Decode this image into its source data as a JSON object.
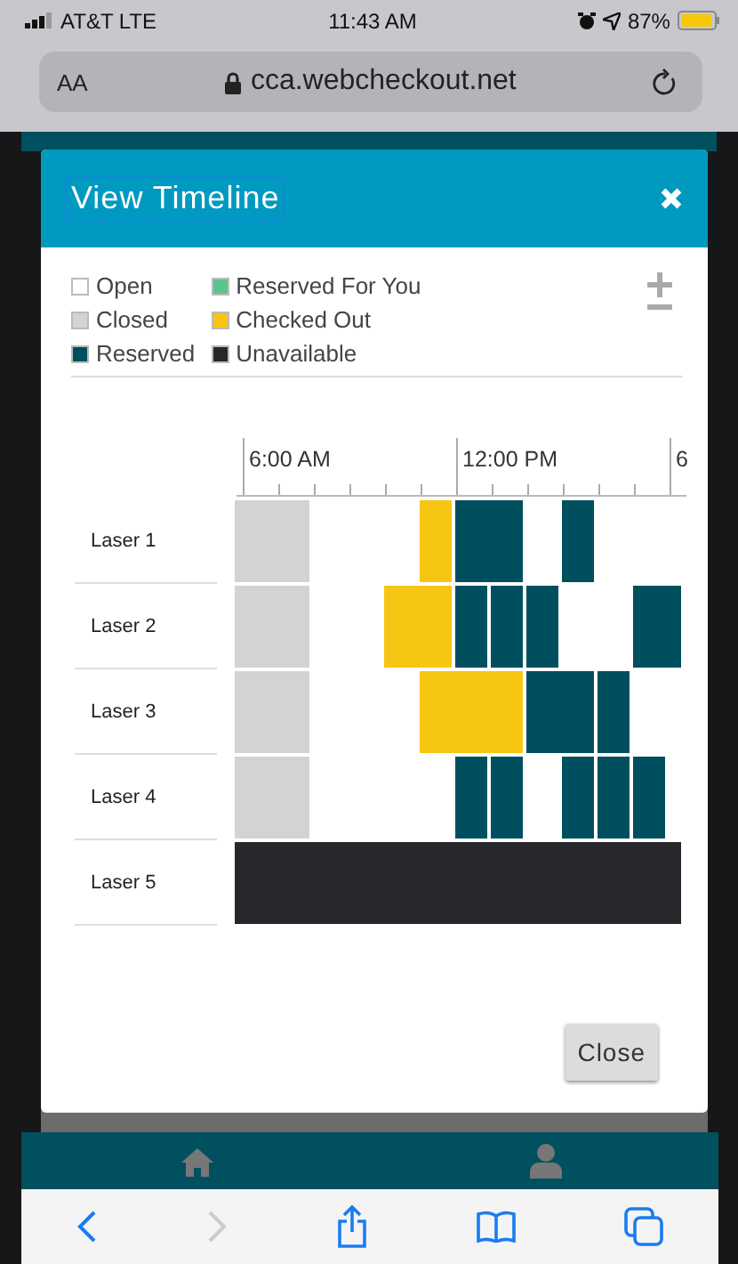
{
  "status_bar": {
    "carrier": "AT&T LTE",
    "time": "11:43 AM",
    "battery": "87%"
  },
  "address_bar": {
    "text_size": "AA",
    "url": "cca.webcheckout.net"
  },
  "dialog": {
    "title": "View Timeline",
    "legend": [
      {
        "label": "Open",
        "kind": "open",
        "color": "#ffffff"
      },
      {
        "label": "Closed",
        "kind": "closed",
        "color": "#d3d3d3"
      },
      {
        "label": "Reserved",
        "kind": "reserved",
        "color": "#004f5f"
      },
      {
        "label": "Reserved For You",
        "kind": "mine",
        "color": "#5cc58e"
      },
      {
        "label": "Checked Out",
        "kind": "checkedout",
        "color": "#f7c514"
      },
      {
        "label": "Unavailable",
        "kind": "unavailable",
        "color": "#27282c"
      }
    ],
    "time_labels": [
      "6:00 AM",
      "12:00 PM",
      "6"
    ],
    "resources": [
      {
        "name": "Laser 1",
        "slots": [
          {
            "kind": "closed",
            "joined": false
          },
          {
            "kind": "closed",
            "joined": true
          },
          {
            "kind": "closed",
            "joined": true
          },
          {
            "kind": "open"
          },
          {
            "kind": "open"
          },
          {
            "kind": "open"
          },
          {
            "kind": "checkedout",
            "joined": false
          },
          {
            "kind": "reserved",
            "joined": false
          },
          {
            "kind": "reserved",
            "joined": true
          },
          {
            "kind": "open"
          },
          {
            "kind": "reserved",
            "joined": false
          },
          {
            "kind": "open"
          },
          {
            "kind": "open"
          },
          {
            "kind": "open"
          }
        ]
      },
      {
        "name": "Laser 2",
        "slots": [
          {
            "kind": "closed",
            "joined": false
          },
          {
            "kind": "closed",
            "joined": true
          },
          {
            "kind": "closed",
            "joined": true
          },
          {
            "kind": "open"
          },
          {
            "kind": "open"
          },
          {
            "kind": "checkedout",
            "joined": false
          },
          {
            "kind": "checkedout",
            "joined": true
          },
          {
            "kind": "reserved",
            "joined": false
          },
          {
            "kind": "reserved",
            "joined": false
          },
          {
            "kind": "reserved",
            "joined": false
          },
          {
            "kind": "open"
          },
          {
            "kind": "open"
          },
          {
            "kind": "reserved",
            "joined": false
          },
          {
            "kind": "reserved",
            "joined": true
          }
        ]
      },
      {
        "name": "Laser 3",
        "slots": [
          {
            "kind": "closed",
            "joined": false
          },
          {
            "kind": "closed",
            "joined": true
          },
          {
            "kind": "closed",
            "joined": true
          },
          {
            "kind": "open"
          },
          {
            "kind": "open"
          },
          {
            "kind": "open"
          },
          {
            "kind": "checkedout",
            "joined": false
          },
          {
            "kind": "checkedout",
            "joined": true
          },
          {
            "kind": "checkedout",
            "joined": true
          },
          {
            "kind": "reserved",
            "joined": false
          },
          {
            "kind": "reserved",
            "joined": true
          },
          {
            "kind": "reserved",
            "joined": false
          },
          {
            "kind": "open"
          },
          {
            "kind": "open"
          }
        ]
      },
      {
        "name": "Laser 4",
        "slots": [
          {
            "kind": "closed",
            "joined": false
          },
          {
            "kind": "closed",
            "joined": true
          },
          {
            "kind": "closed",
            "joined": true
          },
          {
            "kind": "open"
          },
          {
            "kind": "open"
          },
          {
            "kind": "open"
          },
          {
            "kind": "open"
          },
          {
            "kind": "reserved",
            "joined": false
          },
          {
            "kind": "reserved",
            "joined": false
          },
          {
            "kind": "open"
          },
          {
            "kind": "reserved",
            "joined": false
          },
          {
            "kind": "reserved",
            "joined": false
          },
          {
            "kind": "reserved",
            "joined": false
          },
          {
            "kind": "open"
          }
        ]
      },
      {
        "name": "Laser 5",
        "slots": [
          {
            "kind": "unavailable",
            "joined": false
          },
          {
            "kind": "unavailable",
            "joined": true
          },
          {
            "kind": "unavailable",
            "joined": true
          },
          {
            "kind": "unavailable",
            "joined": true
          },
          {
            "kind": "unavailable",
            "joined": true
          },
          {
            "kind": "unavailable",
            "joined": true
          },
          {
            "kind": "unavailable",
            "joined": true
          },
          {
            "kind": "unavailable",
            "joined": true
          },
          {
            "kind": "unavailable",
            "joined": true
          },
          {
            "kind": "unavailable",
            "joined": true
          },
          {
            "kind": "unavailable",
            "joined": true
          },
          {
            "kind": "unavailable",
            "joined": true
          },
          {
            "kind": "unavailable",
            "joined": true
          },
          {
            "kind": "unavailable",
            "joined": true
          }
        ]
      }
    ],
    "close_label": "Close"
  }
}
